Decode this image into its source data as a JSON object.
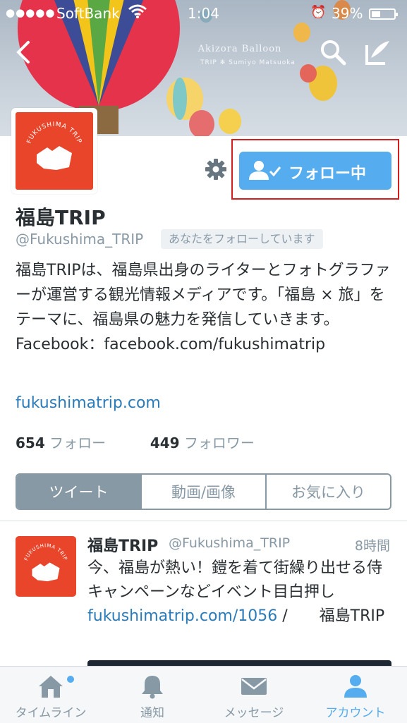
{
  "status_bar": {
    "signal": "●●●●●",
    "carrier": "SoftBank",
    "time": "1:04",
    "battery": "39%"
  },
  "header": {
    "banner_title": "Akizora Balloon",
    "banner_brand": "TRIP",
    "banner_sub": "Sumiyo Matsuoka",
    "back_icon": "chevron-left-icon",
    "search_icon": "search-icon",
    "compose_icon": "compose-icon"
  },
  "profile": {
    "avatar_text": "FUKUSHIMA TRIP",
    "name": "福島TRIP",
    "handle": "@Fukushima_TRIP",
    "follows_you": "あなたをフォローしています",
    "bio": "福島TRIPは、福島県出身のライターとフォトグラファーが運営する観光情報メディアです。「福島 × 旅」をテーマに、福島県の魅力を発信していきます。 Facebook：facebook.com/fukushimatrip",
    "link": "fukushimatrip.com",
    "following_count": "654",
    "following_label": "フォロー",
    "followers_count": "449",
    "followers_label": "フォロワー",
    "follow_button": "フォロー中"
  },
  "tabs": [
    {
      "label": "ツイート"
    },
    {
      "label": "動画/画像"
    },
    {
      "label": "お気に入り"
    }
  ],
  "tweet": {
    "name": "福島TRIP",
    "handle": "@Fukushima_TRIP",
    "time": "8時間",
    "text_plain": "今、福島が熱い！鎧を着て街繰り出せる侍キャンペーンなどイベント目白押し",
    "text_link": "fukushimatrip.com/1056",
    "text_tail": "/ 福島TRIP"
  },
  "tabbar": [
    {
      "label": "タイムライン",
      "icon": "home-icon"
    },
    {
      "label": "通知",
      "icon": "bell-icon"
    },
    {
      "label": "メッセージ",
      "icon": "envelope-icon"
    },
    {
      "label": "アカウント",
      "icon": "person-icon"
    }
  ],
  "colors": {
    "accent": "#55acee",
    "brand_red": "#e8452b",
    "highlight_frame": "#d41e1e",
    "muted": "#8899a6"
  }
}
